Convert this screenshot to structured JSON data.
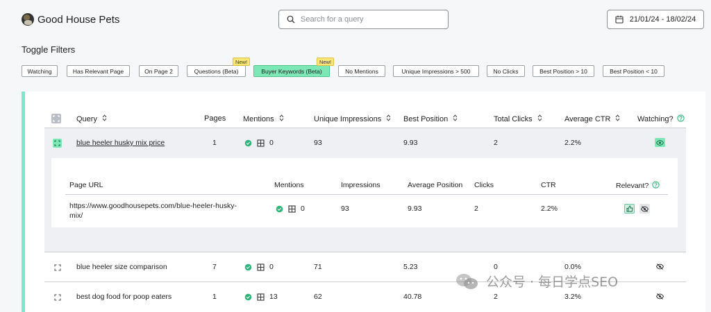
{
  "app": {
    "title": "Good House Pets"
  },
  "search": {
    "placeholder": "Search for a query"
  },
  "date_range": {
    "label": "21/01/24 - 18/02/24"
  },
  "filters": {
    "title": "Toggle Filters",
    "chips": [
      {
        "label": "Watching",
        "active": false,
        "new": false
      },
      {
        "label": "Has Relevant Page",
        "active": false,
        "new": false
      },
      {
        "label": "On Page 2",
        "active": false,
        "new": false
      },
      {
        "label": "Questions (Beta)",
        "active": false,
        "new": true
      },
      {
        "label": "Buyer Keywords (Beta)",
        "active": true,
        "new": true
      },
      {
        "label": "No Mentions",
        "active": false,
        "new": false
      },
      {
        "label": "Unique Impressions > 500",
        "active": false,
        "new": false
      },
      {
        "label": "No Clicks",
        "active": false,
        "new": false
      },
      {
        "label": "Best Position > 10",
        "active": false,
        "new": false
      },
      {
        "label": "Best Position < 10",
        "active": false,
        "new": false
      }
    ],
    "new_badge": "New!"
  },
  "table": {
    "columns": {
      "query": "Query",
      "pages": "Pages",
      "mentions": "Mentions",
      "unique_impressions": "Unique Impressions",
      "best_position": "Best Position",
      "total_clicks": "Total Clicks",
      "average_ctr": "Average CTR",
      "watching": "Watching?"
    },
    "rows": [
      {
        "query": "blue heeler husky mix price",
        "pages": "1",
        "mentions": "0",
        "unique_impressions": "93",
        "best_position": "9.93",
        "total_clicks": "2",
        "average_ctr": "2.2%",
        "watching": true,
        "expanded": true
      },
      {
        "query": "blue heeler size comparison",
        "pages": "7",
        "mentions": "0",
        "unique_impressions": "71",
        "best_position": "5.23",
        "total_clicks": "0",
        "average_ctr": "0.0%",
        "watching": false,
        "expanded": false
      },
      {
        "query": "best dog food for poop eaters",
        "pages": "1",
        "mentions": "13",
        "unique_impressions": "62",
        "best_position": "40.78",
        "total_clicks": "2",
        "average_ctr": "3.2%",
        "watching": false,
        "expanded": false
      }
    ],
    "detail": {
      "columns": {
        "page_url": "Page URL",
        "mentions": "Mentions",
        "impressions": "Impressions",
        "average_position": "Average Position",
        "clicks": "Clicks",
        "ctr": "CTR",
        "relevant": "Relevant?"
      },
      "rows": [
        {
          "page_url_line1": "https://www.goodhousepets.com/blue-heeler-husky-",
          "page_url_line2": "mix/",
          "mentions": "0",
          "impressions": "93",
          "average_position": "9.93",
          "clicks": "2",
          "ctr": "2.2%"
        }
      ]
    }
  },
  "watermark": {
    "text": "公众号 · 每日学点SEO"
  },
  "colors": {
    "accent": "#7de8cb",
    "active_chip": "#7de8b6",
    "new_badge": "#fde57a",
    "check_green": "#2fb57a"
  },
  "icons": [
    "logo-icon",
    "search-icon",
    "calendar-icon",
    "sort-icon",
    "help-icon",
    "expand-icon",
    "check-circle-icon",
    "page-icon",
    "eye-icon",
    "eye-off-icon",
    "thumbs-up-icon",
    "wechat-icon"
  ]
}
